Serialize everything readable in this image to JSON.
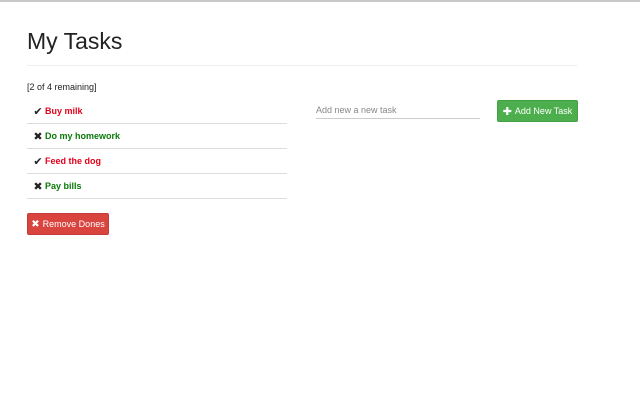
{
  "page": {
    "title": "My Tasks"
  },
  "status": {
    "remaining_text": "[2 of 4 remaining]"
  },
  "tasks": [
    {
      "label": "Buy milk",
      "mark": "✔",
      "mark_icon": "check-icon",
      "done": true,
      "color": "#e3001b"
    },
    {
      "label": "Do my homework",
      "mark": "✖",
      "mark_icon": "x-icon",
      "done": false,
      "color": "#0a7a0a"
    },
    {
      "label": "Feed the dog",
      "mark": "✔",
      "mark_icon": "check-icon",
      "done": true,
      "color": "#e3001b"
    },
    {
      "label": "Pay bills",
      "mark": "✖",
      "mark_icon": "x-icon",
      "done": false,
      "color": "#0a7a0a"
    }
  ],
  "actions": {
    "remove_label": "Remove Dones",
    "remove_icon": "✖",
    "remove_color": "#d9443f",
    "add_label": "Add New Task",
    "add_icon": "✚",
    "add_color": "#4cae4c"
  },
  "new_task": {
    "placeholder": "Add new a new task",
    "value": ""
  }
}
